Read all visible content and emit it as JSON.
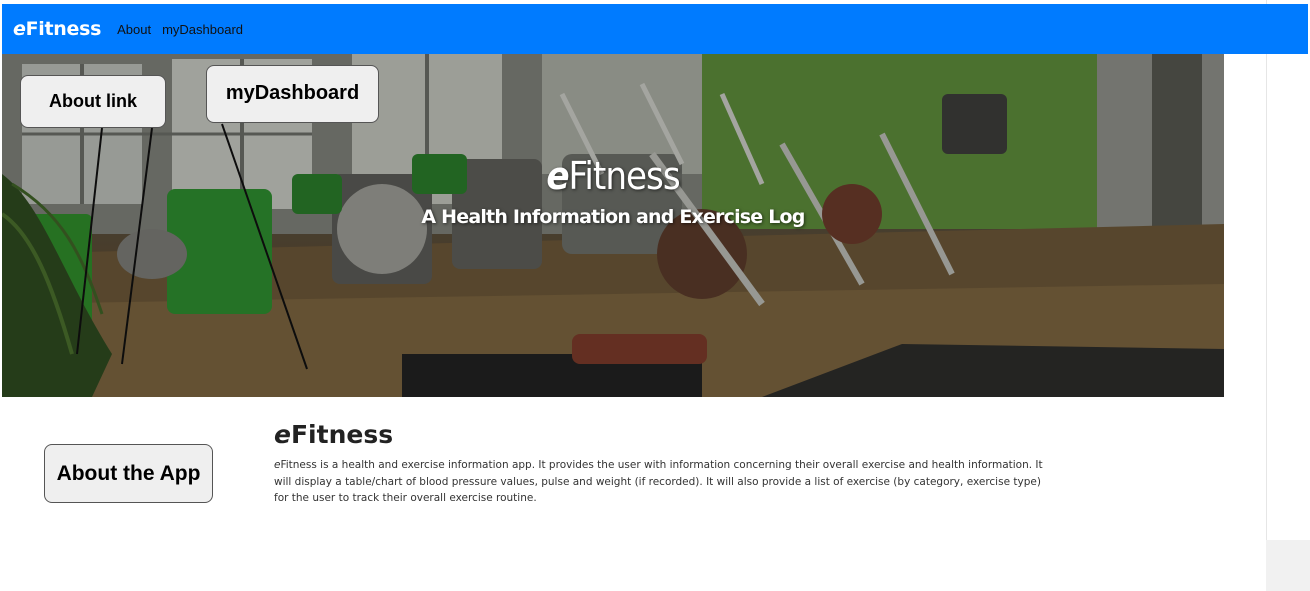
{
  "navbar": {
    "brand_e": "e",
    "brand_rest": "Fitness",
    "links": [
      "About",
      "myDashboard"
    ]
  },
  "hero": {
    "title_e": "e",
    "title_rest": "Fitness",
    "subtitle": "A Health Information and Exercise Log"
  },
  "callouts": {
    "about_link": "About link",
    "dashboard": "myDashboard",
    "about_app": "About the App"
  },
  "content": {
    "title_e": "e",
    "title_rest": "Fitness",
    "text_e": "e",
    "text_rest": "Fitness is a health and exercise information app. It provides the user with information concerning their overall exercise and health information. It will display a table/chart of blood pressure values, pulse and weight (if recorded). It will also provide a list of exercise (by category, exercise type) for the user to track their overall exercise routine."
  },
  "colors": {
    "navbar": "#007bff",
    "callout_bg": "#efefef"
  }
}
